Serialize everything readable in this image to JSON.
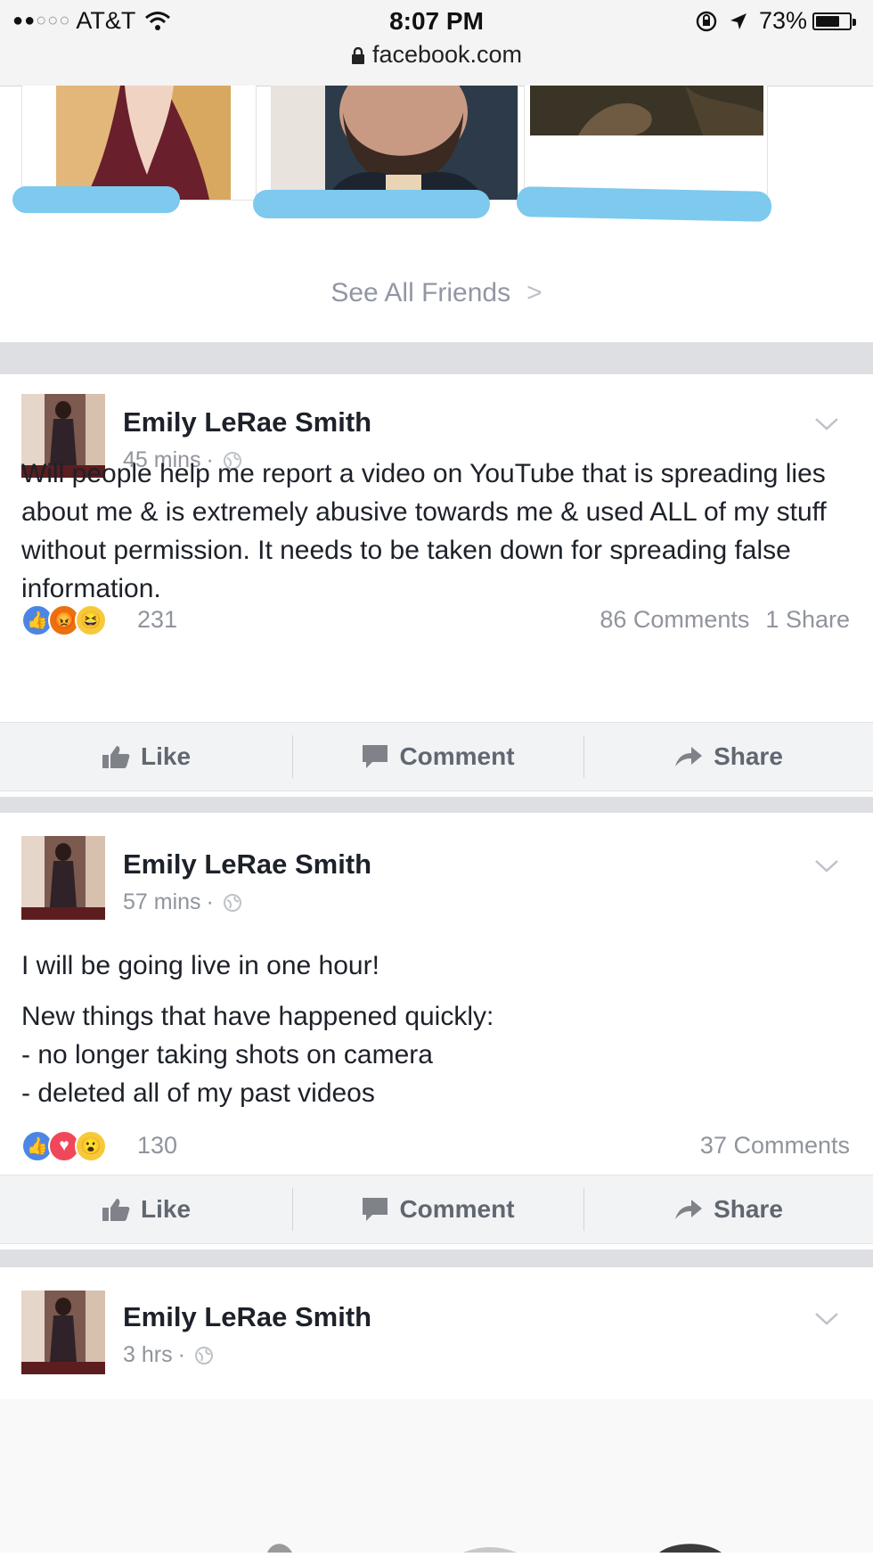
{
  "status_bar": {
    "carrier": "AT&T",
    "time": "8:07 PM",
    "battery": "73%",
    "battery_level": 0.73,
    "url": "facebook.com"
  },
  "friends_section": {
    "see_all_label": "See All Friends",
    "chevron": ">"
  },
  "posts": [
    {
      "author": "Emily LeRae Smith",
      "time": "45 mins",
      "separator": "·",
      "paragraphs": [
        "Will people help me report a video on YouTube that is spreading lies about me & is extremely abusive towards me & used ALL of my stuff without permission. It needs to be taken down for spreading false information."
      ],
      "reactions": [
        "like-icon",
        "angry-icon",
        "haha-icon"
      ],
      "reaction_count": "231",
      "comments": "86 Comments",
      "shares": "1 Share"
    },
    {
      "author": "Emily LeRae Smith",
      "time": "57 mins",
      "separator": "·",
      "paragraphs": [
        "I will be going live in one hour!",
        "New things that have happened quickly:",
        "- no longer taking shots on camera",
        "- deleted all of my past videos"
      ],
      "reactions": [
        "like-icon",
        "love-icon",
        "wow-icon"
      ],
      "reaction_count": "130",
      "comments": "37 Comments"
    },
    {
      "author": "Emily LeRae Smith",
      "time": "3 hrs",
      "separator": "·"
    }
  ],
  "actions": {
    "like": "Like",
    "comment": "Comment",
    "share": "Share"
  },
  "colors": {
    "redaction": "#7ec9ee",
    "like_blue": "#4c86e4",
    "meta_gray": "#90949c"
  }
}
